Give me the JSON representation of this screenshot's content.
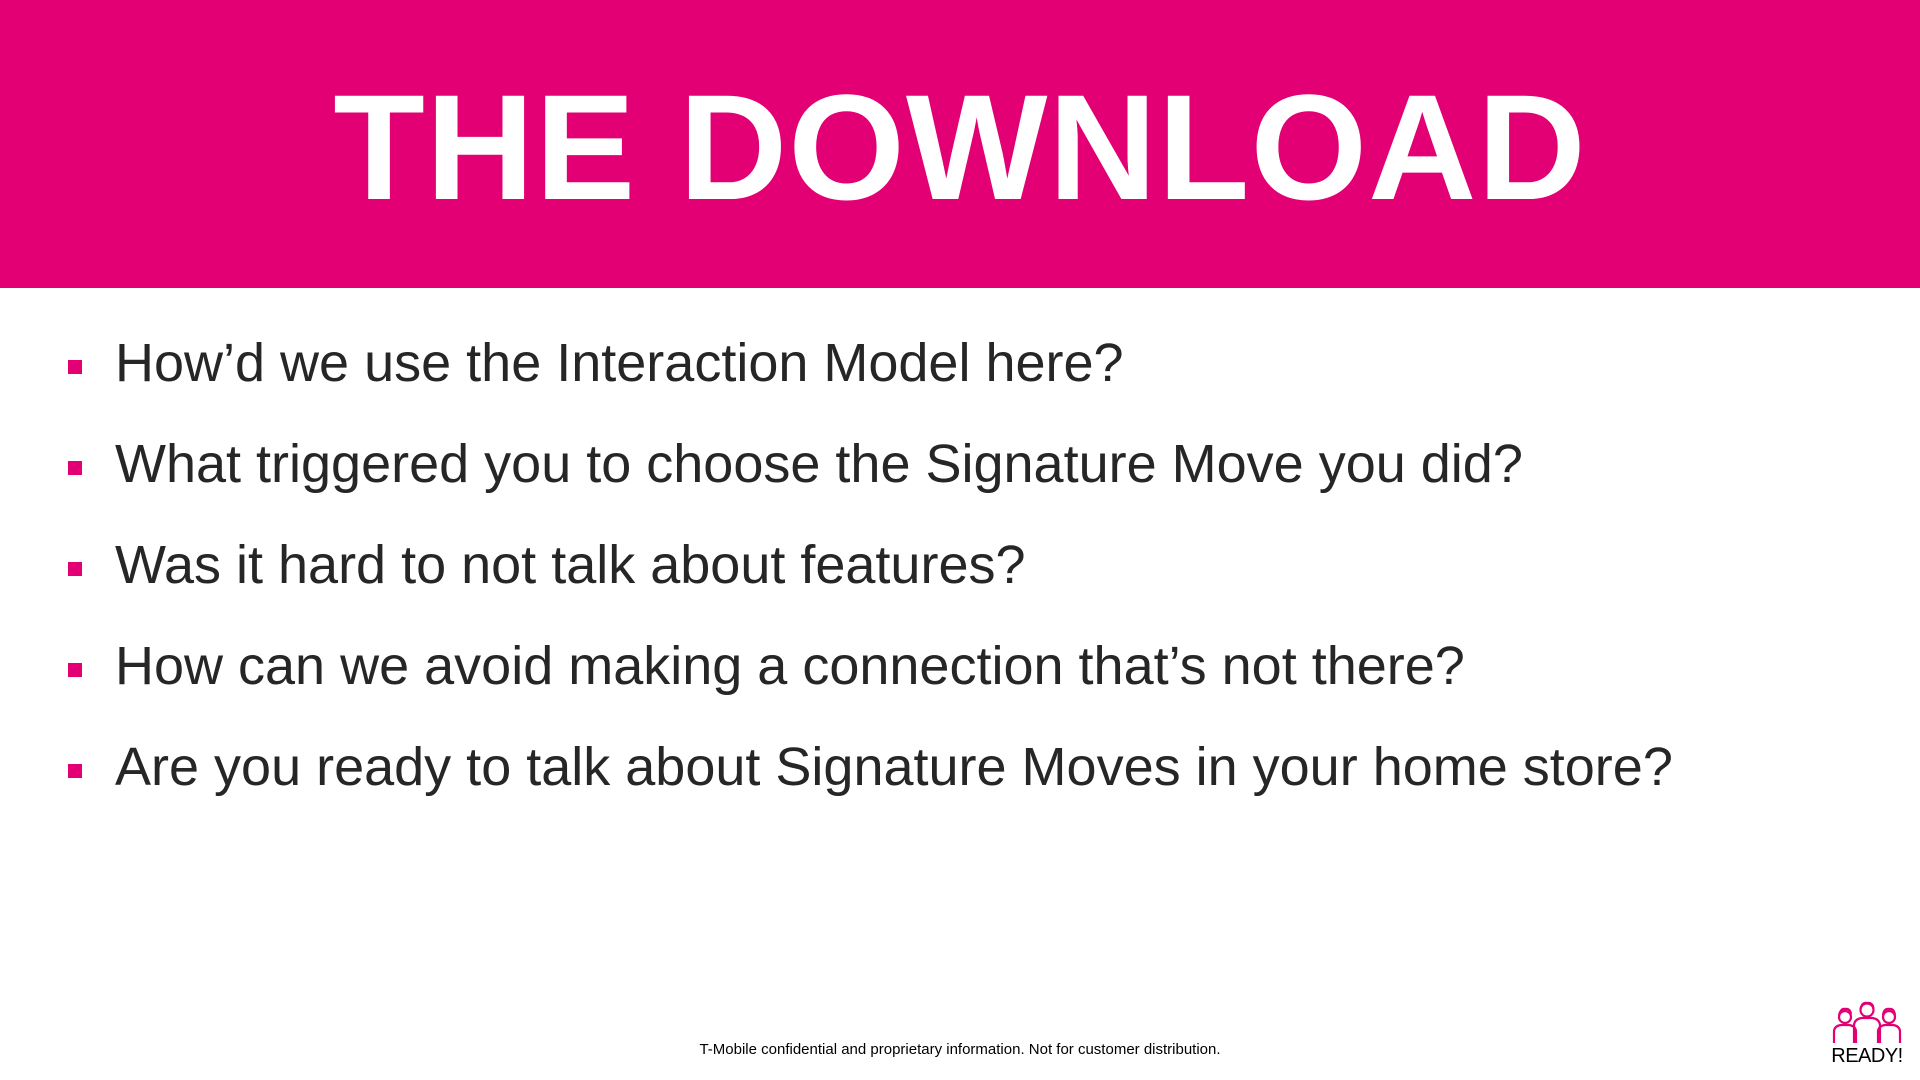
{
  "slide": {
    "title": "THE DOWNLOAD",
    "accent_color": "#e20074",
    "bullets": [
      "How’d we use the Interaction Model here?",
      "What triggered you to choose the Signature Move you did?",
      "Was it hard to not talk about features?",
      "How can we avoid making a connection that’s not there?",
      "Are you ready to talk about Signature Moves in your home store?"
    ],
    "footer": "T-Mobile confidential and proprietary information. Not for customer distribution.",
    "logo": {
      "icon": "three-people-icon",
      "text": "READY!"
    }
  }
}
